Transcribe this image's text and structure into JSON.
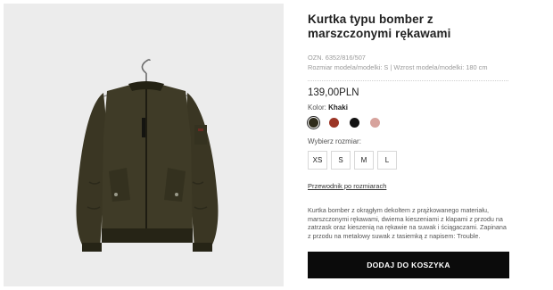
{
  "product": {
    "title": "Kurtka typu bomber z marszczonymi rękawami",
    "ref": "OZN. 6352/816/507",
    "model_info": "Rozmiar modela/modelki: S | Wzrost modela/modelki: 180 cm",
    "price": "139,00PLN",
    "color_label": "Kolor:",
    "color_value": "Khaki",
    "colors": [
      {
        "name": "khaki",
        "hex": "#2f2c1c"
      },
      {
        "name": "red",
        "hex": "#9c3526"
      },
      {
        "name": "black",
        "hex": "#121212"
      },
      {
        "name": "pink",
        "hex": "#d7a39d"
      }
    ],
    "size_label": "Wybierz rozmiar:",
    "sizes": [
      "XS",
      "S",
      "M",
      "L"
    ],
    "size_guide": "Przewodnik po rozmiarach",
    "description": "Kurtka bomber z okrągłym dekoltem z prążkowanego materiału, marszczonymi rękawami, dwiema kieszeniami z klapami z przodu na zatrzask oraz kieszenią na rękawie na suwak i ściągaczami. Zapinana z przodu na metalowy suwak z tasiemką z napisem: Trouble.",
    "add_to_cart": "DODAJ DO KOSZYKA"
  }
}
